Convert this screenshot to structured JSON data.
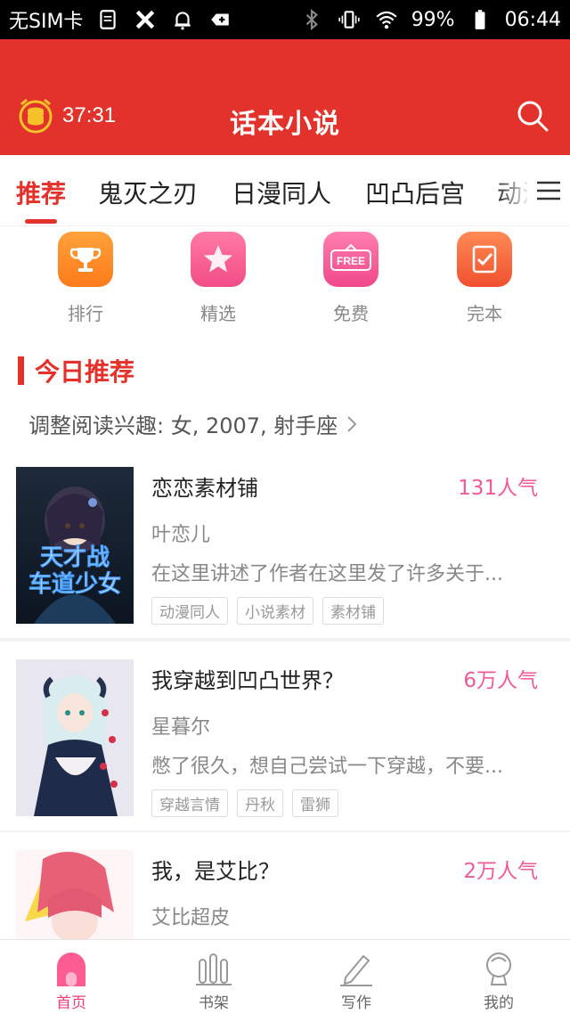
{
  "status_bar": {
    "carrier": "无SIM卡",
    "battery": "99%",
    "time": "06:44"
  },
  "header": {
    "timer": "37:31",
    "title": "话本小说"
  },
  "tabs": [
    {
      "label": "推荐",
      "active": true
    },
    {
      "label": "鬼灭之刃",
      "active": false
    },
    {
      "label": "日漫同人",
      "active": false
    },
    {
      "label": "凹凸后宫",
      "active": false
    },
    {
      "label": "动漫",
      "active": false
    }
  ],
  "quick_entries": [
    {
      "label": "排行",
      "icon": "trophy-icon"
    },
    {
      "label": "精选",
      "icon": "star-icon"
    },
    {
      "label": "免费",
      "icon": "free-icon",
      "badge": "FREE"
    },
    {
      "label": "完本",
      "icon": "finished-icon"
    }
  ],
  "section": {
    "title": "今日推荐",
    "interest": "调整阅读兴趣: 女, 2007, 射手座"
  },
  "books": [
    {
      "title": "恋恋素材铺",
      "popularity": "131人气",
      "author": "叶恋儿",
      "description": "在这里讲述了作者在这里发了许多关于...",
      "tags": [
        "动漫同人",
        "小说素材",
        "素材铺"
      ],
      "cover_text": "天才战车道少女"
    },
    {
      "title": "我穿越到凹凸世界？",
      "popularity": "6万人气",
      "author": "星暮尔",
      "description": "憋了很久，想自己尝试一下穿越，不要...",
      "tags": [
        "穿越言情",
        "丹秋",
        "雷狮"
      ]
    },
    {
      "title": "我，是艾比？",
      "popularity": "2万人气",
      "author": "艾比超皮",
      "description": "",
      "tags": []
    }
  ],
  "bottom_nav": [
    {
      "label": "首页",
      "active": true
    },
    {
      "label": "书架",
      "active": false
    },
    {
      "label": "写作",
      "active": false
    },
    {
      "label": "我的",
      "active": false
    }
  ],
  "colors": {
    "brand_red": "#e2322b",
    "popularity_pink": "#ee5a9a"
  }
}
